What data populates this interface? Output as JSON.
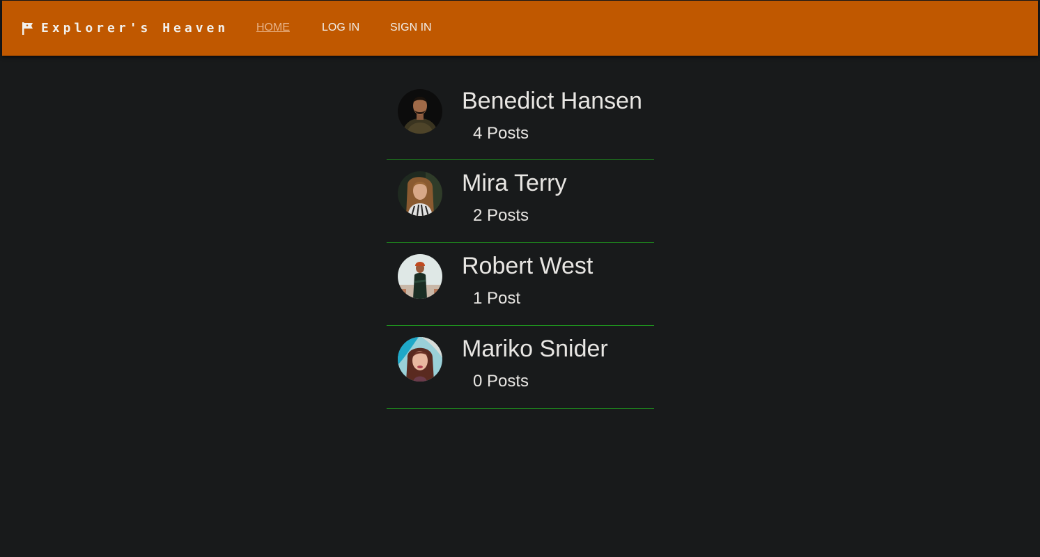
{
  "nav": {
    "brand": "Explorer's Heaven",
    "brand_icon": "flag-icon",
    "links": [
      {
        "label": "HOME",
        "active": true
      },
      {
        "label": "LOG IN",
        "active": false
      },
      {
        "label": "SIGN IN",
        "active": false
      }
    ]
  },
  "users": [
    {
      "name": "Benedict Hansen",
      "posts": "4 Posts",
      "avatar": "avatar-photo"
    },
    {
      "name": "Mira Terry",
      "posts": "2 Posts",
      "avatar": "avatar-photo"
    },
    {
      "name": "Robert West",
      "posts": "1 Post",
      "avatar": "avatar-photo"
    },
    {
      "name": "Mariko Snider",
      "posts": "0 Posts",
      "avatar": "avatar-photo"
    }
  ],
  "colors": {
    "navbar": "#c05800",
    "background": "#181a1b",
    "divider": "#1e8f1e",
    "text": "#e8e6e3"
  }
}
